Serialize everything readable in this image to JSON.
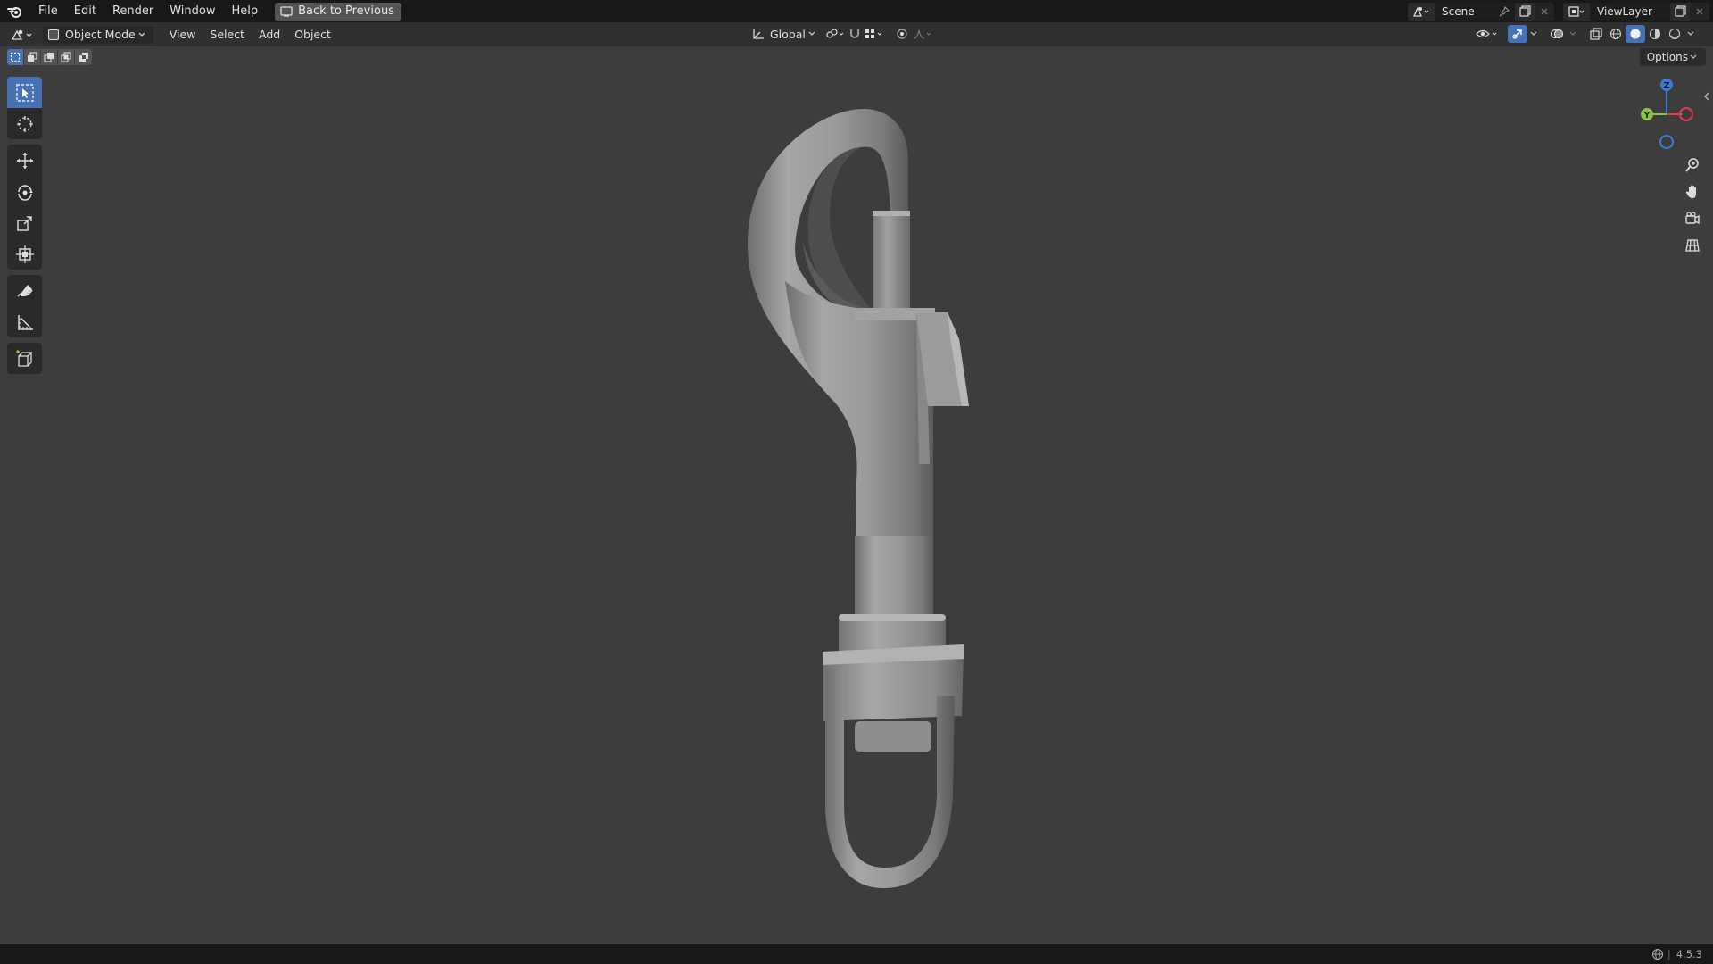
{
  "topbar": {
    "menus": [
      "File",
      "Edit",
      "Render",
      "Window",
      "Help"
    ],
    "back_label": "Back to Previous",
    "scene_name": "Scene",
    "view_layer_name": "ViewLayer"
  },
  "header": {
    "mode": "Object Mode",
    "menus": [
      "View",
      "Select",
      "Add",
      "Object"
    ],
    "orientation": "Global",
    "options_label": "Options"
  },
  "gizmo": {
    "z_label": "Z",
    "y_label": "Y",
    "colors": {
      "x": "#e8394f",
      "y": "#8cc63f",
      "z": "#3b7ad9"
    }
  },
  "status": {
    "version": "4.5.3"
  },
  "theme": {
    "accent": "#4772b3",
    "viewport_bg": "#3d3d3d"
  }
}
